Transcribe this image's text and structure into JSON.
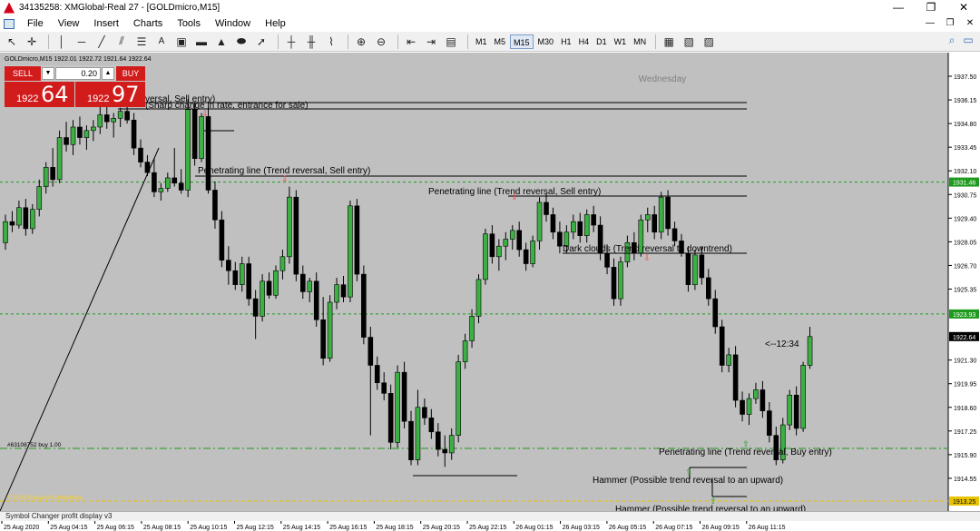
{
  "window": {
    "title": "34135258: XMGlobal-Real 27 - [GOLDmicro,M15]",
    "controls": [
      "—",
      "❐",
      "✕"
    ]
  },
  "menu": {
    "items": [
      "File",
      "View",
      "Insert",
      "Charts",
      "Tools",
      "Window",
      "Help"
    ],
    "mdi_controls": [
      "—",
      "❐",
      "✕"
    ]
  },
  "toolbar": {
    "tool_icons": [
      "cursor-icon",
      "crosshair-icon",
      "vertical-line-icon",
      "horizontal-line-icon",
      "trendline-icon",
      "channel-icon",
      "fibonacci-icon",
      "text-icon",
      "text-label-icon",
      "rectangle-icon",
      "triangle-icon",
      "ellipse-icon",
      "arrow-icon"
    ],
    "timeframes": [
      "M1",
      "M5",
      "M15",
      "M30",
      "H1",
      "H4",
      "D1",
      "W1",
      "MN"
    ],
    "active_timeframe": "M15"
  },
  "chart": {
    "info_line": "GOLDmicro,M15  1922.01 1922.72 1921.64 1922.64",
    "day_label": "Wednesday",
    "countdown": "<--12:34",
    "order_label": "#63108752 buy 1.00",
    "account_label": "© 2020 Copyright faharidaxa",
    "current_price": "1922.64",
    "green_level_1": "1931.46",
    "green_level_2": "1923.93",
    "yellow_level": "1913.25",
    "y_ticks": [
      "1937.50",
      "1936.15",
      "1934.80",
      "1933.45",
      "1932.10",
      "1930.75",
      "1929.40",
      "1928.05",
      "1926.70",
      "1925.35",
      "1921.30",
      "1919.95",
      "1918.60",
      "1917.25",
      "1915.90",
      "1914.55"
    ],
    "x_ticks": [
      "25 Aug 2020",
      "25 Aug 04:15",
      "25 Aug 06:15",
      "25 Aug 08:15",
      "25 Aug 10:15",
      "25 Aug 12:15",
      "25 Aug 14:15",
      "25 Aug 16:15",
      "25 Aug 18:15",
      "25 Aug 20:15",
      "25 Aug 22:15",
      "26 Aug 01:15",
      "26 Aug 03:15",
      "26 Aug 05:15",
      "26 Aug 07:15",
      "26 Aug 09:15",
      "26 Aug 11:15"
    ],
    "annotations": [
      "versal, Sell entry)",
      "(Sharp change in rate, entrance for sale)",
      "Penetrating line (Trend reversal, Sell entry)",
      "Penetrating line (Trend reversal, Sell entry)",
      "Dark clouds (Trend reversal to downtrend)",
      "Penetrating line (Trend reversal, Buy entry)",
      "Hammer (Possible trend reversal to an upward)",
      "Hammer (Possible trend reversal to an upward)"
    ],
    "candles": [
      [
        1928.0,
        1929.6,
        1927.6,
        1929.2
      ],
      [
        1929.2,
        1929.8,
        1928.6,
        1929.0
      ],
      [
        1929.0,
        1930.4,
        1928.8,
        1930.0
      ],
      [
        1930.0,
        1930.5,
        1928.4,
        1928.8
      ],
      [
        1928.8,
        1930.2,
        1928.5,
        1929.9
      ],
      [
        1929.9,
        1931.6,
        1929.5,
        1931.2
      ],
      [
        1931.2,
        1932.6,
        1930.8,
        1932.3
      ],
      [
        1932.3,
        1933.4,
        1931.2,
        1931.6
      ],
      [
        1931.6,
        1934.4,
        1931.4,
        1934.0
      ],
      [
        1934.0,
        1934.9,
        1933.2,
        1933.6
      ],
      [
        1933.6,
        1935.0,
        1933.0,
        1934.6
      ],
      [
        1934.6,
        1935.2,
        1933.6,
        1934.0
      ],
      [
        1934.0,
        1934.7,
        1933.3,
        1934.4
      ],
      [
        1934.4,
        1935.0,
        1933.8,
        1934.6
      ],
      [
        1934.6,
        1935.8,
        1934.2,
        1935.3
      ],
      [
        1935.3,
        1936.2,
        1934.5,
        1934.9
      ],
      [
        1934.9,
        1935.4,
        1934.0,
        1935.1
      ],
      [
        1935.1,
        1935.7,
        1934.6,
        1935.5
      ],
      [
        1935.5,
        1936.5,
        1934.8,
        1935.0
      ],
      [
        1935.0,
        1935.4,
        1933.0,
        1933.4
      ],
      [
        1933.4,
        1933.9,
        1932.3,
        1932.6
      ],
      [
        1932.6,
        1933.0,
        1931.8,
        1932.0
      ],
      [
        1932.0,
        1932.8,
        1930.6,
        1930.9
      ],
      [
        1930.9,
        1931.4,
        1930.4,
        1931.1
      ],
      [
        1931.1,
        1932.0,
        1930.9,
        1931.7
      ],
      [
        1931.7,
        1933.4,
        1931.2,
        1931.4
      ],
      [
        1931.4,
        1932.2,
        1930.8,
        1931.0
      ],
      [
        1931.0,
        1936.2,
        1930.6,
        1935.6
      ],
      [
        1935.6,
        1936.0,
        1932.4,
        1932.8
      ],
      [
        1932.8,
        1935.4,
        1932.6,
        1935.2
      ],
      [
        1935.2,
        1935.8,
        1930.8,
        1931.0
      ],
      [
        1931.0,
        1931.5,
        1928.8,
        1929.3
      ],
      [
        1929.3,
        1929.8,
        1926.6,
        1927.0
      ],
      [
        1927.0,
        1927.8,
        1925.6,
        1926.4
      ],
      [
        1926.4,
        1926.9,
        1925.3,
        1925.6
      ],
      [
        1925.6,
        1927.2,
        1925.2,
        1926.8
      ],
      [
        1926.8,
        1927.2,
        1924.4,
        1924.8
      ],
      [
        1924.8,
        1925.3,
        1922.5,
        1923.8
      ],
      [
        1923.8,
        1926.2,
        1923.5,
        1925.8
      ],
      [
        1925.8,
        1926.3,
        1924.8,
        1925.0
      ],
      [
        1925.0,
        1926.7,
        1924.8,
        1926.4
      ],
      [
        1926.4,
        1927.6,
        1925.9,
        1927.2
      ],
      [
        1927.2,
        1931.2,
        1926.8,
        1930.6
      ],
      [
        1930.6,
        1931.0,
        1925.8,
        1926.2
      ],
      [
        1926.2,
        1926.7,
        1924.8,
        1925.2
      ],
      [
        1925.2,
        1926.0,
        1924.6,
        1925.8
      ],
      [
        1925.8,
        1926.3,
        1923.2,
        1923.6
      ],
      [
        1923.6,
        1924.9,
        1921.0,
        1921.4
      ],
      [
        1921.4,
        1925.0,
        1921.2,
        1924.6
      ],
      [
        1924.6,
        1926.0,
        1924.2,
        1925.6
      ],
      [
        1925.6,
        1926.1,
        1924.6,
        1924.9
      ],
      [
        1924.9,
        1930.4,
        1924.6,
        1930.1
      ],
      [
        1930.1,
        1930.5,
        1925.8,
        1926.2
      ],
      [
        1926.2,
        1926.7,
        1922.2,
        1922.6
      ],
      [
        1922.6,
        1923.2,
        1917.0,
        1921.0
      ],
      [
        1921.0,
        1921.5,
        1919.6,
        1920.0
      ],
      [
        1920.0,
        1920.6,
        1919.0,
        1919.4
      ],
      [
        1919.4,
        1919.9,
        1916.2,
        1916.6
      ],
      [
        1916.6,
        1921.0,
        1916.3,
        1920.6
      ],
      [
        1920.6,
        1921.2,
        1917.4,
        1917.8
      ],
      [
        1917.8,
        1918.4,
        1915.3,
        1915.6
      ],
      [
        1915.6,
        1919.6,
        1915.3,
        1918.6
      ],
      [
        1918.6,
        1919.1,
        1917.6,
        1918.0
      ],
      [
        1918.0,
        1918.5,
        1916.8,
        1917.2
      ],
      [
        1917.2,
        1917.7,
        1915.8,
        1916.2
      ],
      [
        1916.2,
        1917.0,
        1915.2,
        1916.0
      ],
      [
        1916.0,
        1917.4,
        1915.6,
        1917.0
      ],
      [
        1917.0,
        1921.6,
        1916.6,
        1921.2
      ],
      [
        1921.2,
        1922.8,
        1920.8,
        1922.4
      ],
      [
        1922.4,
        1924.2,
        1922.0,
        1923.8
      ],
      [
        1923.8,
        1926.2,
        1923.4,
        1925.9
      ],
      [
        1925.9,
        1928.8,
        1925.6,
        1928.5
      ],
      [
        1928.5,
        1929.0,
        1926.8,
        1927.2
      ],
      [
        1927.2,
        1928.2,
        1926.4,
        1927.8
      ],
      [
        1927.8,
        1928.6,
        1927.0,
        1928.2
      ],
      [
        1928.2,
        1929.0,
        1927.6,
        1928.7
      ],
      [
        1928.7,
        1929.2,
        1927.2,
        1927.6
      ],
      [
        1927.6,
        1928.0,
        1926.4,
        1926.8
      ],
      [
        1926.8,
        1928.4,
        1926.6,
        1928.1
      ],
      [
        1928.1,
        1930.6,
        1927.6,
        1930.3
      ],
      [
        1930.3,
        1930.8,
        1929.2,
        1929.6
      ],
      [
        1929.6,
        1930.0,
        1928.2,
        1928.6
      ],
      [
        1928.6,
        1929.2,
        1927.4,
        1927.8
      ],
      [
        1927.8,
        1929.0,
        1927.4,
        1928.6
      ],
      [
        1928.6,
        1929.6,
        1928.2,
        1929.2
      ],
      [
        1929.2,
        1929.7,
        1928.0,
        1928.4
      ],
      [
        1928.4,
        1929.9,
        1928.0,
        1929.6
      ],
      [
        1929.6,
        1930.1,
        1928.6,
        1929.0
      ],
      [
        1929.0,
        1929.5,
        1927.0,
        1927.4
      ],
      [
        1927.4,
        1927.9,
        1926.2,
        1926.6
      ],
      [
        1926.6,
        1927.1,
        1924.4,
        1924.8
      ],
      [
        1924.8,
        1927.2,
        1924.4,
        1926.9
      ],
      [
        1926.9,
        1928.4,
        1926.6,
        1928.0
      ],
      [
        1928.0,
        1928.6,
        1927.0,
        1927.4
      ],
      [
        1927.4,
        1929.6,
        1927.2,
        1929.3
      ],
      [
        1929.3,
        1930.0,
        1928.6,
        1929.6
      ],
      [
        1929.6,
        1930.1,
        1928.2,
        1928.6
      ],
      [
        1928.6,
        1930.9,
        1928.2,
        1930.6
      ],
      [
        1930.6,
        1931.0,
        1928.4,
        1928.8
      ],
      [
        1928.8,
        1929.2,
        1927.8,
        1928.1
      ],
      [
        1928.1,
        1928.5,
        1927.2,
        1927.4
      ],
      [
        1927.4,
        1927.8,
        1925.2,
        1925.6
      ],
      [
        1925.6,
        1927.6,
        1925.3,
        1927.3
      ],
      [
        1927.3,
        1927.8,
        1925.6,
        1926.0
      ],
      [
        1926.0,
        1926.5,
        1924.4,
        1924.8
      ],
      [
        1924.8,
        1925.3,
        1922.8,
        1923.2
      ],
      [
        1923.2,
        1923.6,
        1920.6,
        1921.0
      ],
      [
        1921.0,
        1922.0,
        1920.6,
        1921.6
      ],
      [
        1921.6,
        1922.1,
        1918.6,
        1919.0
      ],
      [
        1919.0,
        1919.5,
        1917.8,
        1918.2
      ],
      [
        1918.2,
        1919.4,
        1917.6,
        1919.1
      ],
      [
        1919.1,
        1920.0,
        1918.8,
        1919.6
      ],
      [
        1919.6,
        1920.1,
        1918.0,
        1918.4
      ],
      [
        1918.4,
        1918.9,
        1916.6,
        1917.0
      ],
      [
        1917.0,
        1917.5,
        1915.3,
        1915.6
      ],
      [
        1915.6,
        1918.0,
        1915.4,
        1917.6
      ],
      [
        1917.6,
        1919.6,
        1917.3,
        1919.3
      ],
      [
        1919.3,
        1919.8,
        1917.0,
        1917.4
      ],
      [
        1917.4,
        1921.2,
        1917.2,
        1921.0
      ],
      [
        1921.0,
        1923.2,
        1920.8,
        1922.64
      ]
    ]
  }
}
